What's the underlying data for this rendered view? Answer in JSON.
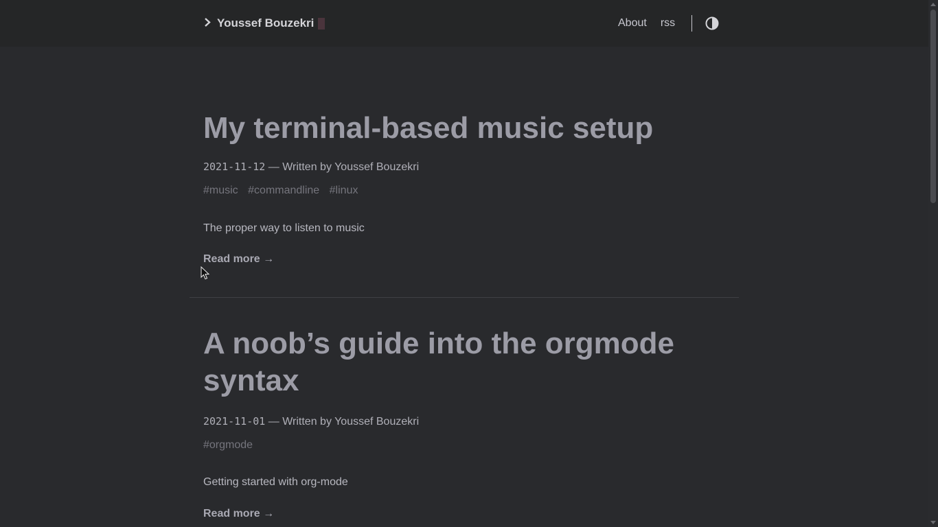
{
  "header": {
    "logo_prefix_icon": "chevron-right-icon",
    "site_title": "Youssef Bouzekri",
    "nav": [
      {
        "label": "About"
      },
      {
        "label": "rss"
      }
    ],
    "theme_toggle_icon": "contrast-icon"
  },
  "posts": [
    {
      "title": "My terminal-based music setup",
      "date": "2021-11-12",
      "byline": "— Written by Youssef Bouzekri",
      "tags": [
        "#music",
        "#commandline",
        "#linux"
      ],
      "summary": "The proper way to listen to music",
      "read_more": "Read more →"
    },
    {
      "title_line1": "A noob’s guide into the orgmode",
      "title_line2": "syntax",
      "date": "2021-11-01",
      "byline": "— Written by Youssef Bouzekri",
      "tags": [
        "#orgmode"
      ],
      "summary": "Getting started with org-mode",
      "read_more": "Read more →"
    }
  ]
}
